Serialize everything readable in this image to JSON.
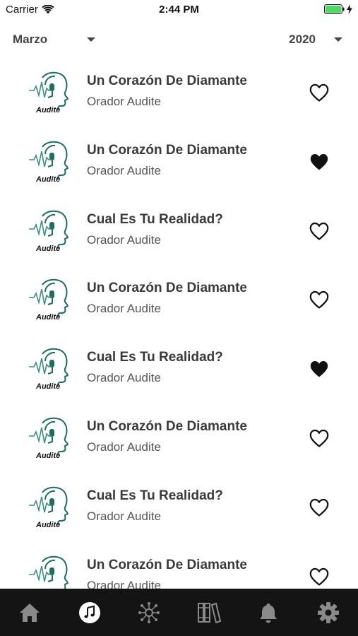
{
  "status": {
    "carrier": "Carrier",
    "time": "2:44 PM"
  },
  "filters": {
    "month": "Marzo",
    "year": "2020"
  },
  "logo_text": "Audite",
  "items": [
    {
      "title": "Un Corazón De Diamante",
      "subtitle": "Orador Audite",
      "favorite": false
    },
    {
      "title": "Un Corazón De Diamante",
      "subtitle": "Orador Audite",
      "favorite": true
    },
    {
      "title": "Cual Es Tu Realidad?",
      "subtitle": "Orador Audite",
      "favorite": false
    },
    {
      "title": "Un Corazón De Diamante",
      "subtitle": "Orador Audite",
      "favorite": false
    },
    {
      "title": "Cual Es Tu Realidad?",
      "subtitle": "Orador Audite",
      "favorite": true
    },
    {
      "title": "Un Corazón De Diamante",
      "subtitle": "Orador Audite",
      "favorite": false
    },
    {
      "title": "Cual Es Tu Realidad?",
      "subtitle": "Orador Audite",
      "favorite": false
    },
    {
      "title": "Un Corazón De Diamante",
      "subtitle": "Orador Audite",
      "favorite": false
    }
  ],
  "tabs": [
    {
      "name": "home-icon",
      "active": false
    },
    {
      "name": "music-note-icon",
      "active": true
    },
    {
      "name": "network-icon",
      "active": false
    },
    {
      "name": "library-icon",
      "active": false
    },
    {
      "name": "bell-icon",
      "active": false
    },
    {
      "name": "gear-icon",
      "active": false
    }
  ],
  "colors": {
    "logo_teal": "#1f6f5c",
    "tab_bar_bg": "#141414",
    "tab_icon": "#8a8a8a",
    "tab_icon_active": "#ffffff",
    "heart": "#111111"
  }
}
